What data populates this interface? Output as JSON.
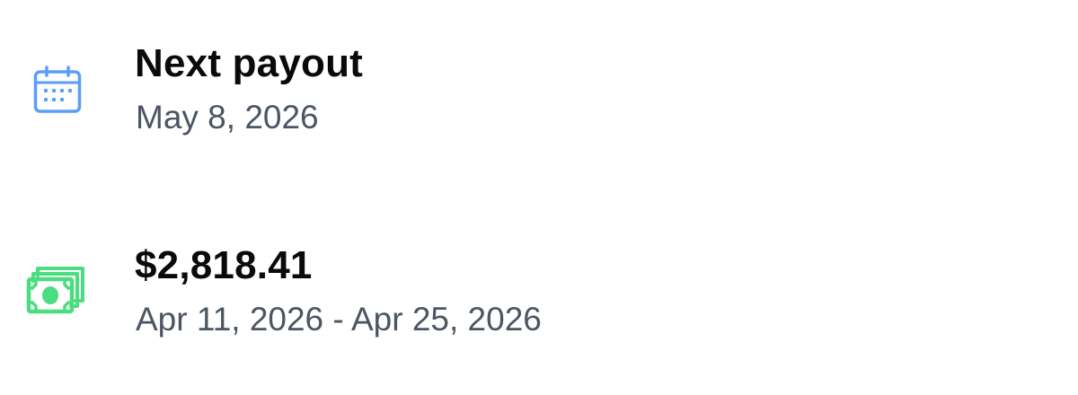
{
  "next_payout": {
    "icon": "calendar-icon",
    "icon_color": "#5b9ef9",
    "title": "Next payout",
    "date": "May 8, 2026"
  },
  "payout_amount": {
    "icon": "cash-icon",
    "icon_color": "#4ade80",
    "amount": "$2,818.41",
    "period": "Apr 11, 2026 - Apr 25, 2026"
  }
}
